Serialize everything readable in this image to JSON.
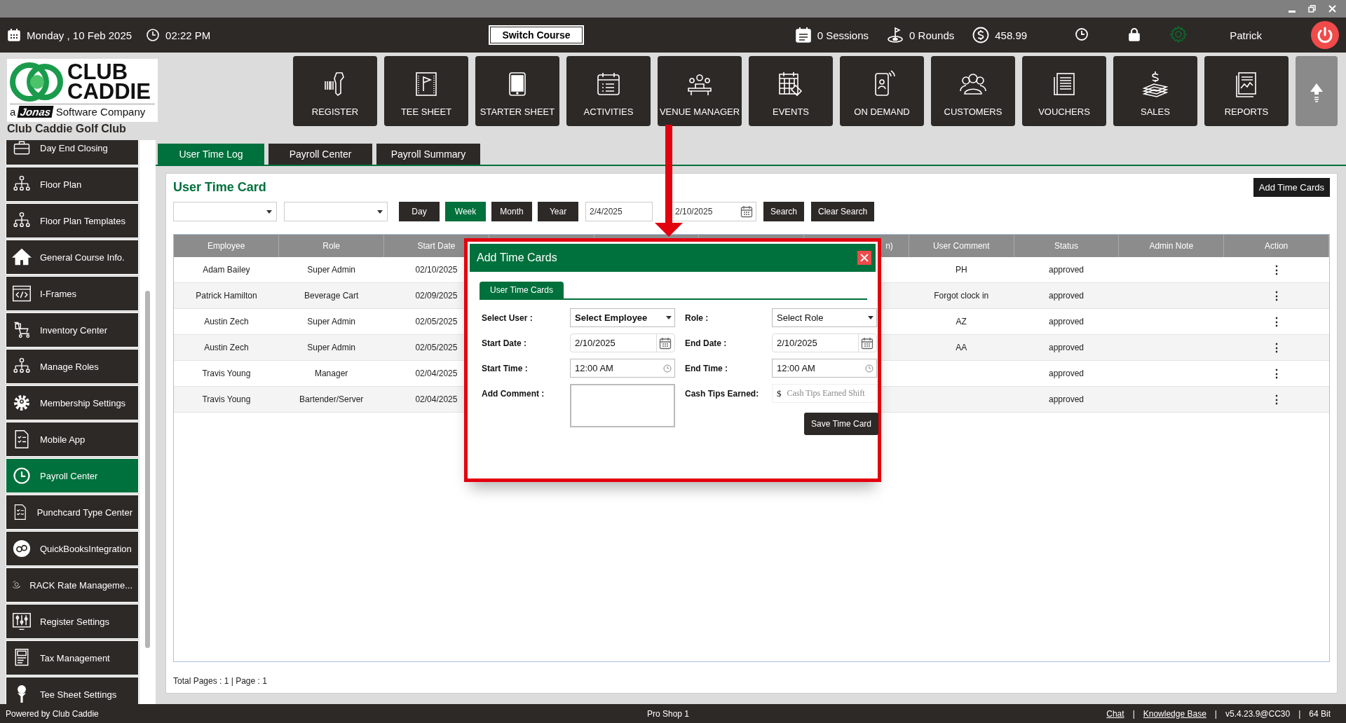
{
  "top_bar": {
    "date": "Monday ,  10 Feb 2025",
    "time": "02:22 PM",
    "switch_button": "Switch Course",
    "sessions": "0 Sessions",
    "rounds": "0 Rounds",
    "balance": "458.99",
    "user": "Patrick"
  },
  "logo": {
    "line_1": "CLUB",
    "line_2": "CADDIE",
    "prefix": "a",
    "brand": "Jonas",
    "tagline": "Software Company"
  },
  "club_name": "Club Caddie Golf Club",
  "nav": [
    {
      "label": "REGISTER"
    },
    {
      "label": "TEE SHEET"
    },
    {
      "label": "STARTER SHEET"
    },
    {
      "label": "ACTIVITIES"
    },
    {
      "label": "VENUE MANAGER"
    },
    {
      "label": "EVENTS"
    },
    {
      "label": "ON DEMAND"
    },
    {
      "label": "CUSTOMERS"
    },
    {
      "label": "VOUCHERS"
    },
    {
      "label": "SALES"
    },
    {
      "label": "REPORTS"
    }
  ],
  "sidebar": {
    "items": [
      {
        "label": "Day End Closing",
        "selected": false
      },
      {
        "label": "Floor Plan",
        "selected": false
      },
      {
        "label": "Floor Plan Templates",
        "selected": false
      },
      {
        "label": "General Course Info.",
        "selected": false
      },
      {
        "label": "I-Frames",
        "selected": false
      },
      {
        "label": "Inventory Center",
        "selected": false
      },
      {
        "label": "Manage Roles",
        "selected": false
      },
      {
        "label": "Membership Settings",
        "selected": false
      },
      {
        "label": "Mobile App",
        "selected": false
      },
      {
        "label": "Payroll Center",
        "selected": true
      },
      {
        "label": "Punchcard Type Center",
        "selected": false
      },
      {
        "label": "QuickBooksIntegration",
        "selected": false
      },
      {
        "label": "RACK Rate Manageme...",
        "selected": false
      },
      {
        "label": "Register Settings",
        "selected": false
      },
      {
        "label": "Tax Management",
        "selected": false
      },
      {
        "label": "Tee Sheet Settings",
        "selected": false
      }
    ]
  },
  "tabs": [
    {
      "label": "User Time Log",
      "selected": true
    },
    {
      "label": "Payroll Center",
      "selected": false
    },
    {
      "label": "Payroll Summary",
      "selected": false
    }
  ],
  "panel": {
    "title": "User Time Card",
    "add_button": "Add Time Cards",
    "periods": [
      {
        "label": "Day",
        "selected": false
      },
      {
        "label": "Week",
        "selected": true
      },
      {
        "label": "Month",
        "selected": false
      },
      {
        "label": "Year",
        "selected": false
      }
    ],
    "from_date": "2/4/2025",
    "to_date": "2/10/2025",
    "search_button": "Search",
    "clear_button": "Clear Search"
  },
  "table": {
    "columns": [
      {
        "label": "Employee"
      },
      {
        "label": "Role"
      },
      {
        "label": "Start Date"
      },
      {},
      {},
      {},
      {
        "label": "n)",
        "kind": "clipped"
      },
      {
        "label": "User Comment"
      },
      {
        "label": "Status"
      },
      {
        "label": "Admin Note"
      },
      {
        "label": "Action"
      }
    ],
    "rows": [
      {
        "employee": "Adam Bailey",
        "role": "Super Admin",
        "start_date": "02/10/2025",
        "user_comment": "PH",
        "status": "approved",
        "action": "⋮"
      },
      {
        "employee": "Patrick Hamilton",
        "role": "Beverage Cart",
        "start_date": "02/09/2025",
        "user_comment": "Forgot clock in",
        "status": "approved",
        "action": "⋮"
      },
      {
        "employee": "Austin Zech",
        "role": "Super Admin",
        "start_date": "02/05/2025",
        "user_comment": "AZ",
        "status": "approved",
        "action": "⋮"
      },
      {
        "employee": "Austin Zech",
        "role": "Super Admin",
        "start_date": "02/05/2025",
        "user_comment": "AA",
        "status": "approved",
        "action": "⋮"
      },
      {
        "employee": "Travis Young",
        "role": "Manager",
        "start_date": "02/04/2025",
        "status": "approved",
        "action": "⋮"
      },
      {
        "employee": "Travis Young",
        "role": "Bartender/Server",
        "start_date": "02/04/2025",
        "status": "approved",
        "action": "⋮"
      }
    ]
  },
  "pagination": "Total Pages : 1 | Page : 1",
  "modal": {
    "title": "Add Time Cards",
    "tab": {
      "label": "User Time Cards",
      "selected": true
    },
    "fields": [
      {
        "label": "Select User :",
        "kind": "select",
        "value": "Select Employee",
        "emphasized": true
      },
      {
        "label": "Role :",
        "kind": "select",
        "value": "Select Role",
        "emphasized": false
      },
      {
        "label": "Start Date :",
        "kind": "date",
        "value": "2/10/2025"
      },
      {
        "label": "End Date :",
        "kind": "date",
        "value": "2/10/2025"
      },
      {
        "label": "Start Time :",
        "kind": "time",
        "value": "12:00 AM"
      },
      {
        "label": "End Time :",
        "kind": "time",
        "value": "12:00 AM"
      },
      {
        "label": "Add Comment :",
        "kind": "textarea"
      },
      {
        "label": "Cash Tips Earned:",
        "kind": "money",
        "prefix": "$",
        "placeholder": "Cash Tips Earned Shift"
      }
    ],
    "save_button": "Save Time Card"
  },
  "status_bar": {
    "left": "Powered by Club Caddie",
    "center": "Pro Shop 1",
    "right": [
      {
        "text": "Chat",
        "kind": "link"
      },
      {
        "text": "|",
        "kind": "separator"
      },
      {
        "text": "Knowledge Base",
        "kind": "link"
      },
      {
        "text": "|",
        "kind": "separator"
      },
      {
        "text": "v5.4.23.9@CC30",
        "kind": "text"
      },
      {
        "text": "|",
        "kind": "separator"
      },
      {
        "text": "64 Bit",
        "kind": "text"
      }
    ]
  }
}
